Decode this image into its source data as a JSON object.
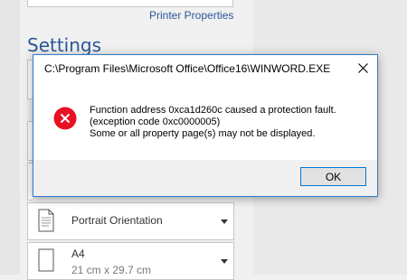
{
  "backstage": {
    "printer_properties_link": "Printer Properties",
    "settings_heading": "Settings",
    "orientation": {
      "label": "Portrait Orientation"
    },
    "paper": {
      "label": "A4",
      "size": "21 cm x 29.7 cm"
    }
  },
  "dialog": {
    "title": "C:\\Program Files\\Microsoft Office\\Office16\\WINWORD.EXE",
    "message_line1": "Function address 0xca1d260c caused a protection fault.",
    "message_line2": "(exception code 0xc0000005)",
    "message_line3": "Some or all property page(s) may not be displayed.",
    "ok_label": "OK",
    "icon": "error-icon",
    "accent_color": "#2f7cc9",
    "error_color": "#e81123"
  }
}
